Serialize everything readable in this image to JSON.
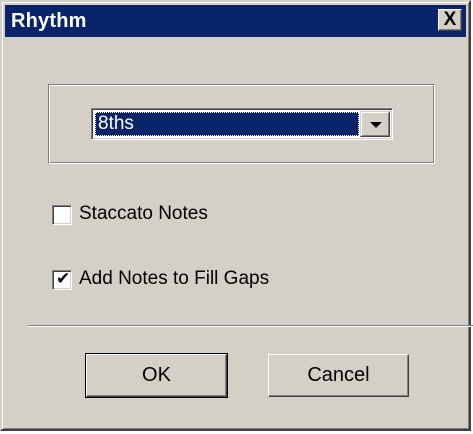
{
  "window": {
    "title": "Rhythm",
    "close_symbol": "X"
  },
  "rhythm_select": {
    "selected": "8ths"
  },
  "options": {
    "staccato": {
      "label": "Staccato Notes",
      "checked": false,
      "mark": ""
    },
    "fill_gaps": {
      "label": "Add Notes to Fill Gaps",
      "checked": true,
      "mark": "✔"
    }
  },
  "buttons": {
    "ok": "OK",
    "cancel": "Cancel"
  },
  "colors": {
    "titlebar": "#0a246a",
    "face": "#d4d0c8",
    "selection": "#0a246a"
  }
}
